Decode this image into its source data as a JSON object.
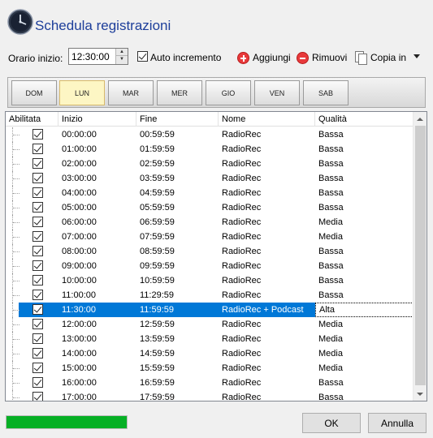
{
  "header": {
    "title": "Schedula registrazioni",
    "icon": "clock-icon"
  },
  "toolbar": {
    "orario_label": "Orario inizio:",
    "orario_value": "12:30:00",
    "auto_label": "Auto incremento",
    "auto_checked": true,
    "add_label": "Aggiungi",
    "remove_label": "Rimuovi",
    "copy_label": "Copia in"
  },
  "days": {
    "items": [
      {
        "label": "DOM",
        "selected": false
      },
      {
        "label": "LUN",
        "selected": true
      },
      {
        "label": "MAR",
        "selected": false
      },
      {
        "label": "MER",
        "selected": false
      },
      {
        "label": "GIO",
        "selected": false
      },
      {
        "label": "VEN",
        "selected": false
      },
      {
        "label": "SAB",
        "selected": false
      }
    ]
  },
  "grid": {
    "columns": [
      "Abilitata",
      "Inizio",
      "Fine",
      "Nome",
      "Qualità"
    ],
    "rows": [
      {
        "inizio": "00:00:00",
        "fine": "00:59:59",
        "nome": "RadioRec",
        "qualita": "Bassa"
      },
      {
        "inizio": "01:00:00",
        "fine": "01:59:59",
        "nome": "RadioRec",
        "qualita": "Bassa"
      },
      {
        "inizio": "02:00:00",
        "fine": "02:59:59",
        "nome": "RadioRec",
        "qualita": "Bassa"
      },
      {
        "inizio": "03:00:00",
        "fine": "03:59:59",
        "nome": "RadioRec",
        "qualita": "Bassa"
      },
      {
        "inizio": "04:00:00",
        "fine": "04:59:59",
        "nome": "RadioRec",
        "qualita": "Bassa"
      },
      {
        "inizio": "05:00:00",
        "fine": "05:59:59",
        "nome": "RadioRec",
        "qualita": "Bassa"
      },
      {
        "inizio": "06:00:00",
        "fine": "06:59:59",
        "nome": "RadioRec",
        "qualita": "Media"
      },
      {
        "inizio": "07:00:00",
        "fine": "07:59:59",
        "nome": "RadioRec",
        "qualita": "Media"
      },
      {
        "inizio": "08:00:00",
        "fine": "08:59:59",
        "nome": "RadioRec",
        "qualita": "Bassa"
      },
      {
        "inizio": "09:00:00",
        "fine": "09:59:59",
        "nome": "RadioRec",
        "qualita": "Bassa"
      },
      {
        "inizio": "10:00:00",
        "fine": "10:59:59",
        "nome": "RadioRec",
        "qualita": "Bassa"
      },
      {
        "inizio": "11:00:00",
        "fine": "11:29:59",
        "nome": "RadioRec",
        "qualita": "Bassa"
      },
      {
        "inizio": "11:30:00",
        "fine": "11:59:59",
        "nome": "RadioRec + Podcast",
        "qualita": "Alta",
        "selected": true
      },
      {
        "inizio": "12:00:00",
        "fine": "12:59:59",
        "nome": "RadioRec",
        "qualita": "Media"
      },
      {
        "inizio": "13:00:00",
        "fine": "13:59:59",
        "nome": "RadioRec",
        "qualita": "Media"
      },
      {
        "inizio": "14:00:00",
        "fine": "14:59:59",
        "nome": "RadioRec",
        "qualita": "Media"
      },
      {
        "inizio": "15:00:00",
        "fine": "15:59:59",
        "nome": "RadioRec",
        "qualita": "Media"
      },
      {
        "inizio": "16:00:00",
        "fine": "16:59:59",
        "nome": "RadioRec",
        "qualita": "Bassa"
      },
      {
        "inizio": "17:00:00",
        "fine": "17:59:59",
        "nome": "RadioRec",
        "qualita": "Bassa"
      }
    ]
  },
  "footer": {
    "progress_fraction": 1.0,
    "ok_label": "OK",
    "cancel_label": "Annulla"
  },
  "colors": {
    "title": "#1d3e9a",
    "selection": "#0078d7",
    "progress": "#06b025",
    "day_selected": "#fdf6c4"
  }
}
